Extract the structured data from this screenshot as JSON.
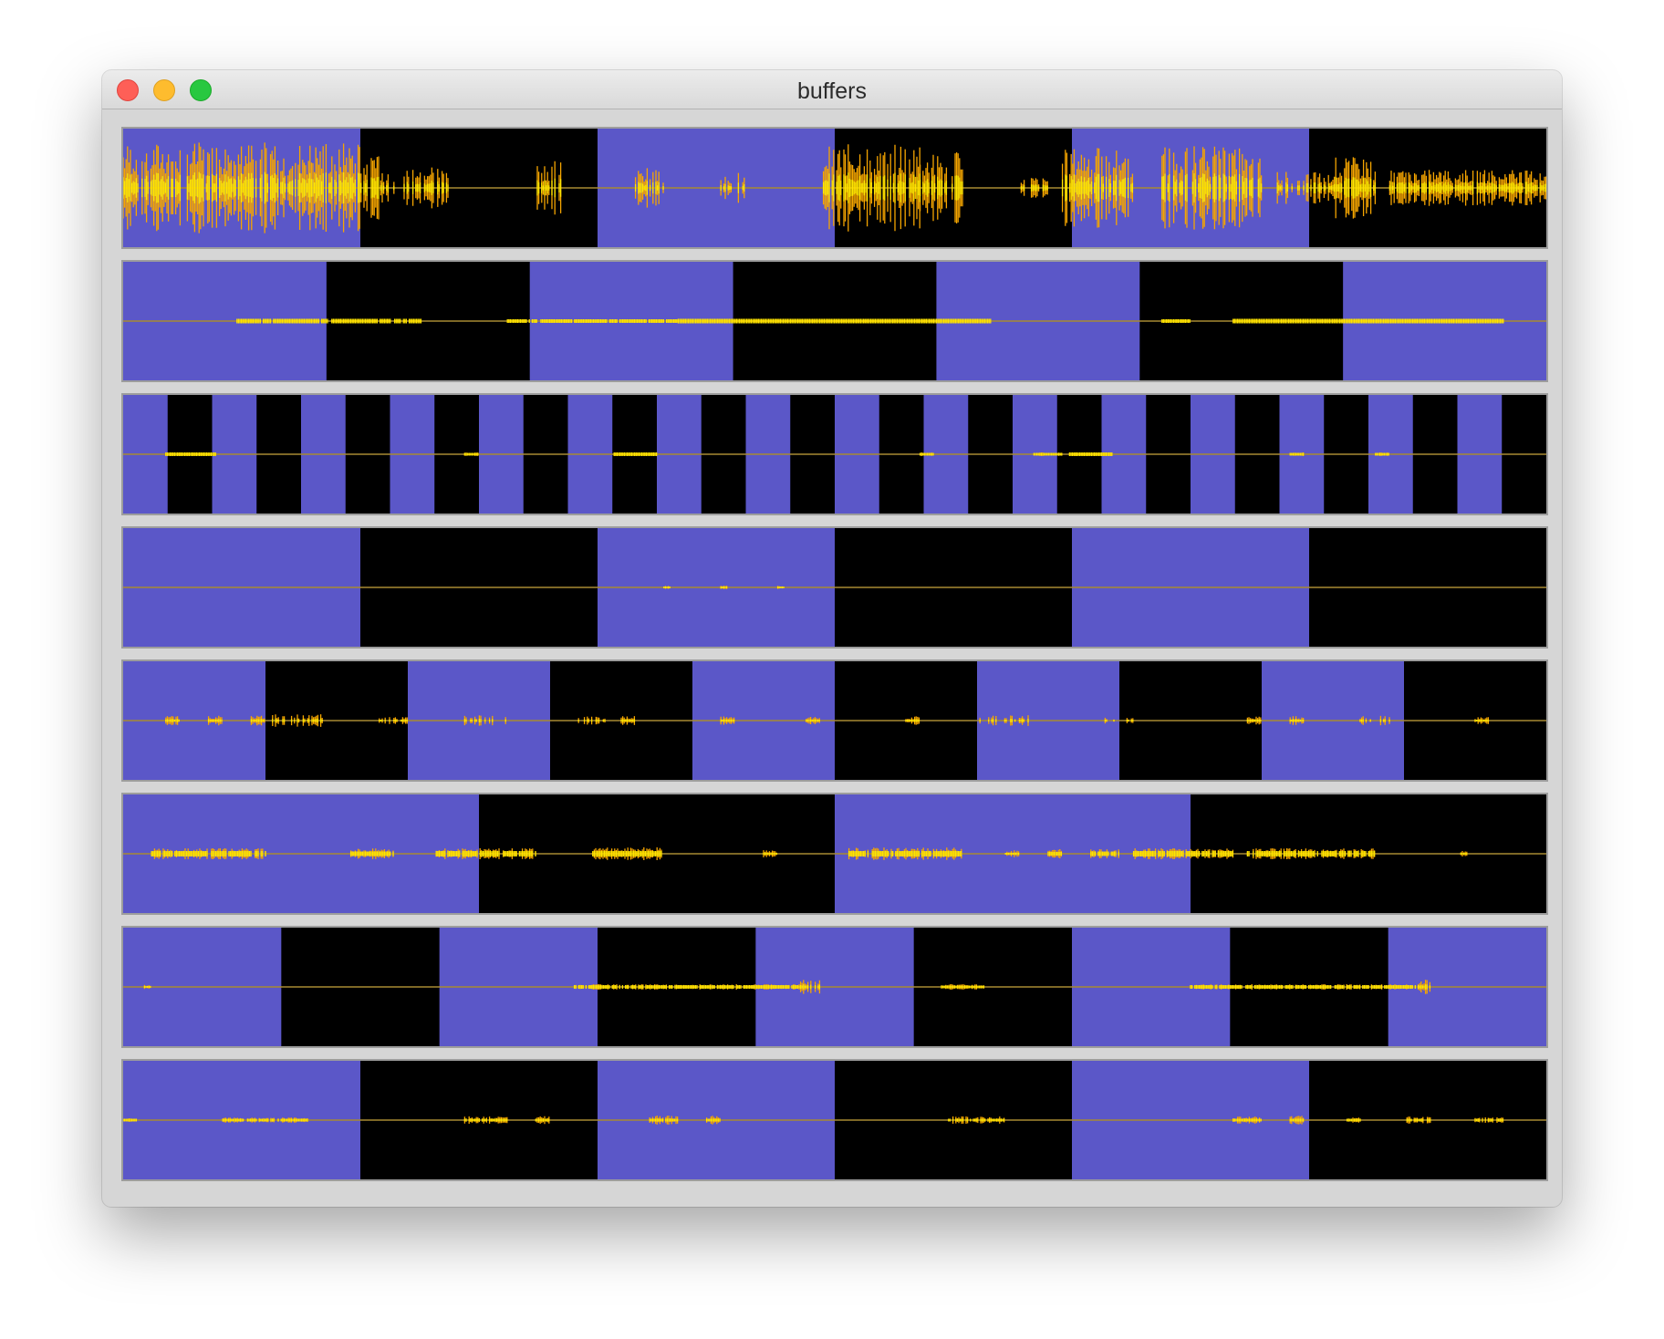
{
  "window": {
    "title": "buffers"
  },
  "colors": {
    "segment_a": "#5b57c8",
    "segment_b": "#000000",
    "waveform_outer": "#f5a500",
    "waveform_inner": "#ffe600",
    "baseline": "#a88a33",
    "frame": "#9d9d9d"
  },
  "icons": {
    "close": "red-traffic-light",
    "minimize": "yellow-traffic-light",
    "maximize": "green-traffic-light"
  },
  "buffers": [
    {
      "segments": 6,
      "activity": "dense-speech"
    },
    {
      "segments": 7,
      "activity": "low-continuous"
    },
    {
      "segments": 32,
      "activity": "sparse-blips"
    },
    {
      "segments": 6,
      "activity": "near-silent"
    },
    {
      "segments": 10,
      "activity": "sparse-ticks"
    },
    {
      "segments": 4,
      "activity": "bursty-thick"
    },
    {
      "segments": 9,
      "activity": "long-sustained"
    },
    {
      "segments": 6,
      "activity": "low-clustered"
    }
  ]
}
